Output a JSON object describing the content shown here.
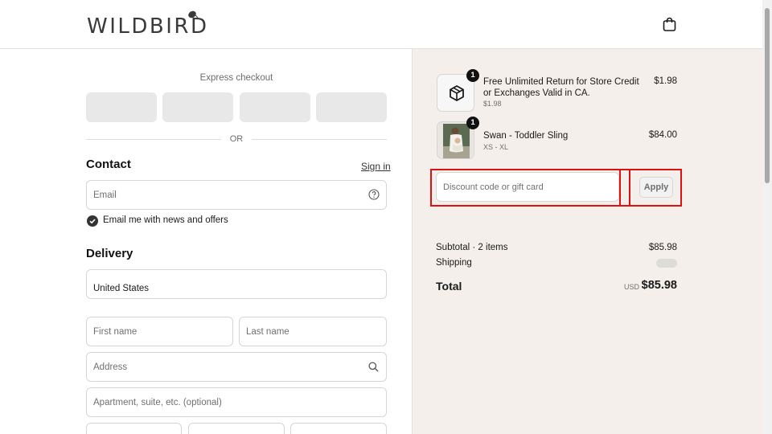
{
  "brand": {
    "name": "WILDBIRD"
  },
  "header": {
    "cart_icon": "shopping-bag-icon"
  },
  "express": {
    "title": "Express checkout",
    "or_label": "OR"
  },
  "contact": {
    "title": "Contact",
    "signin_label": "Sign in",
    "email_placeholder": "Email",
    "help_icon": "question-circle-icon",
    "newsletter_label": "Email me with news and offers",
    "newsletter_checked": true
  },
  "delivery": {
    "title": "Delivery",
    "country_value": "United States",
    "first_name_placeholder": "First name",
    "last_name_placeholder": "Last name",
    "address_placeholder": "Address",
    "search_icon": "search-icon",
    "apartment_placeholder": "Apartment, suite, etc. (optional)"
  },
  "cart": {
    "items": [
      {
        "quantity": "1",
        "name": "Free Unlimited Return for Store Credit or Exchanges Valid in CA.",
        "variant": "$1.98",
        "price": "$1.98",
        "icon": "package-icon"
      },
      {
        "quantity": "1",
        "name": "Swan - Toddler Sling",
        "variant": "XS - XL",
        "price": "$84.00",
        "icon": "product-photo"
      }
    ],
    "discount_placeholder": "Discount code or gift card",
    "apply_label": "Apply"
  },
  "summary": {
    "subtotal_label": "Subtotal · 2 items",
    "subtotal_value": "$85.98",
    "shipping_label": "Shipping",
    "total_label": "Total",
    "currency": "USD",
    "total_value": "$85.98"
  },
  "colors": {
    "sidebar_bg": "#f4efea",
    "highlight": "#dd1111",
    "button_bg": "#e8e8e8"
  }
}
